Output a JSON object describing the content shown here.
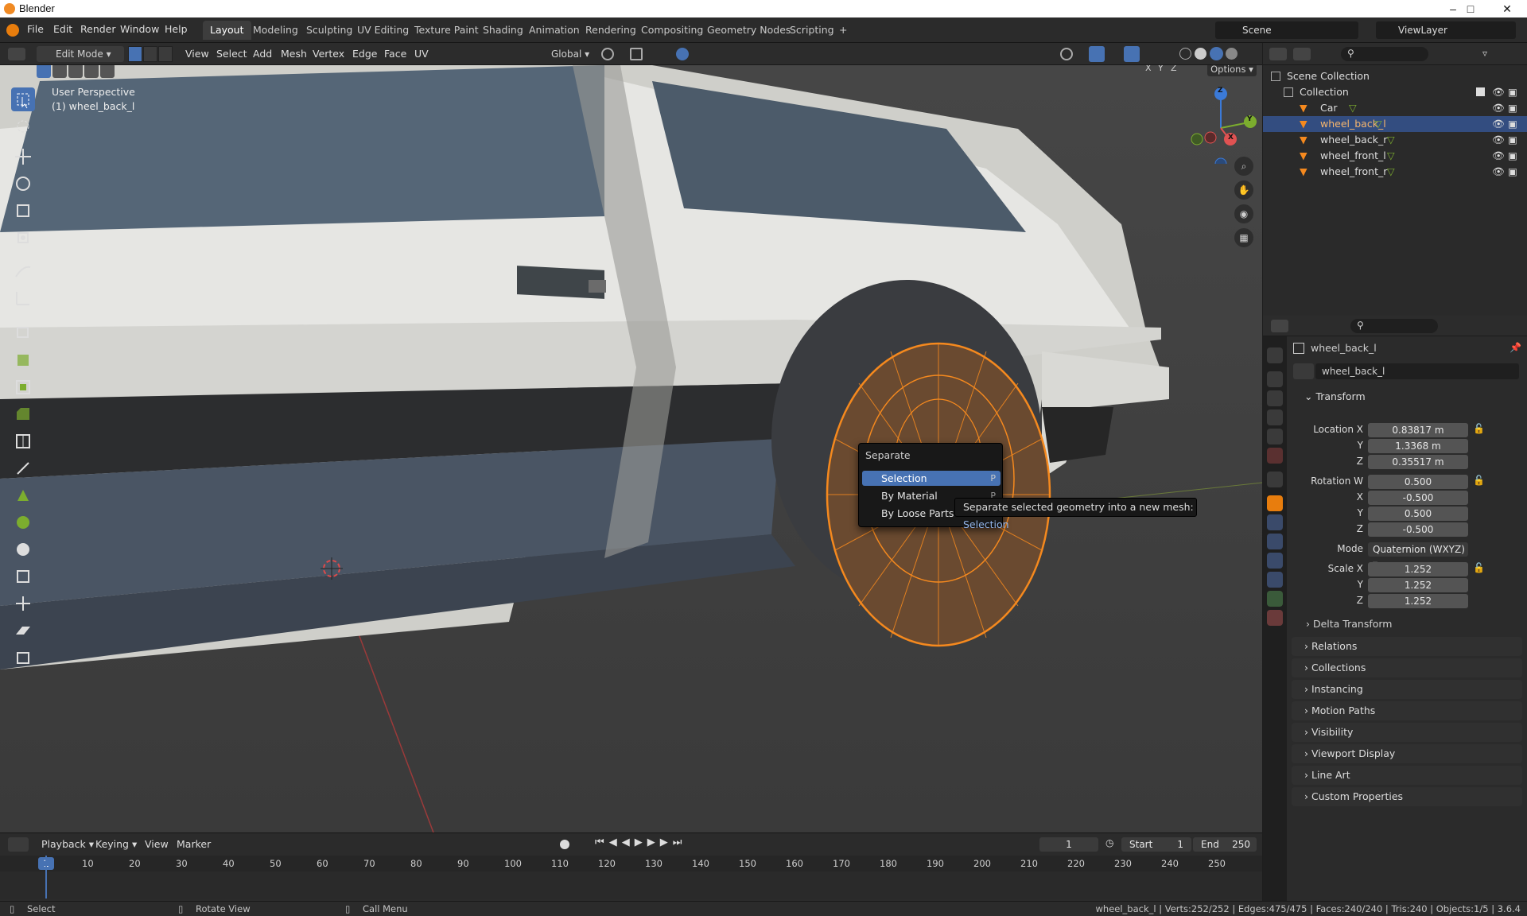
{
  "app": {
    "title": "Blender"
  },
  "menu": [
    "File",
    "Edit",
    "Render",
    "Window",
    "Help"
  ],
  "workspaces": [
    "Layout",
    "Modeling",
    "Sculpting",
    "UV Editing",
    "Texture Paint",
    "Shading",
    "Animation",
    "Rendering",
    "Compositing",
    "Geometry Nodes",
    "Scripting"
  ],
  "workspace_add": "+",
  "scene": {
    "label": "Scene",
    "view_layer": "ViewLayer"
  },
  "viewport_header": {
    "mode": "Edit Mode",
    "menus": [
      "View",
      "Select",
      "Add",
      "Mesh",
      "Vertex",
      "Edge",
      "Face",
      "UV"
    ],
    "orientation": "Global",
    "options": "Options",
    "axes": [
      "X",
      "Y",
      "Z"
    ]
  },
  "viewport": {
    "perspective": "User Perspective",
    "object_label": "(1) wheel_back_l",
    "gizmo": {
      "z": "Z",
      "y": "Y",
      "x": "X"
    }
  },
  "separate_menu": {
    "title": "Separate",
    "items": [
      {
        "label": "Selection",
        "shortcut": "P"
      },
      {
        "label": "By Material",
        "shortcut": "P"
      },
      {
        "label": "By Loose Parts",
        "shortcut": ""
      }
    ]
  },
  "tooltip": {
    "text": "Separate selected geometry into a new mesh:",
    "highlight": "Selection"
  },
  "outliner": {
    "scene_collection": "Scene Collection",
    "collection": "Collection",
    "objects": [
      "Car",
      "wheel_back_l",
      "wheel_back_r",
      "wheel_front_l",
      "wheel_front_r"
    ],
    "selected": "wheel_back_l"
  },
  "properties": {
    "object_name": "wheel_back_l",
    "data_name": "wheel_back_l",
    "transform_title": "Transform",
    "location": {
      "label": "Location X",
      "x": "0.83817 m",
      "y": "1.3368 m",
      "z": "0.35517 m"
    },
    "rotation": {
      "label": "Rotation W",
      "w": "0.500",
      "x": "-0.500",
      "y": "0.500",
      "z": "-0.500"
    },
    "mode_label": "Mode",
    "mode": "Quaternion (WXYZ)",
    "scale": {
      "label": "Scale X",
      "x": "1.252",
      "y": "1.252",
      "z": "1.252"
    },
    "axis_y": "Y",
    "axis_z": "Z",
    "axis_x": "X",
    "delta": "Delta Transform",
    "panels": [
      "Relations",
      "Collections",
      "Instancing",
      "Motion Paths",
      "Visibility",
      "Viewport Display",
      "Line Art",
      "Custom Properties"
    ]
  },
  "timeline": {
    "menus": [
      "Playback",
      "Keying",
      "View",
      "Marker"
    ],
    "current_frame": "1",
    "start_label": "Start",
    "start": "1",
    "end_label": "End",
    "end": "250",
    "ruler": [
      "1",
      "10",
      "20",
      "30",
      "40",
      "50",
      "60",
      "70",
      "80",
      "90",
      "100",
      "110",
      "120",
      "130",
      "140",
      "150",
      "160",
      "170",
      "180",
      "190",
      "200",
      "210",
      "220",
      "230",
      "240",
      "250"
    ]
  },
  "status": {
    "left": [
      "Select",
      "Rotate View",
      "Call Menu"
    ],
    "right": "wheel_back_l | Verts:252/252 | Edges:475/475 | Faces:240/240 | Tris:240 | Objects:1/5 | 3.6.4"
  },
  "colors": {
    "accent": "#4772b3",
    "selection": "#f5891e",
    "bg": "#3f3f3f"
  }
}
